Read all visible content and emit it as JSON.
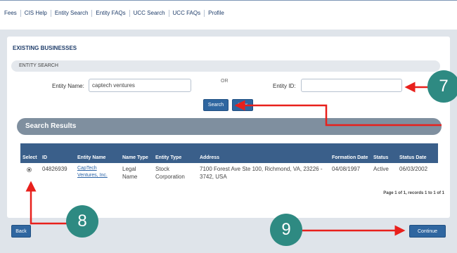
{
  "nav": {
    "links": [
      "Fees",
      "CIS Help",
      "Entity Search",
      "Entity FAQs",
      "UCC Search",
      "UCC FAQs",
      "Profile"
    ]
  },
  "page": {
    "title": "EXISTING BUSINESSES",
    "entity_search_label": "ENTITY SEARCH",
    "entity_name_label": "Entity Name:",
    "entity_name_value": "captech ventures",
    "or_label": "OR",
    "entity_id_label": "Entity ID:",
    "entity_id_value": "",
    "search_button": "Search",
    "clear_button": "Clear"
  },
  "results": {
    "header": "Search Results",
    "columns": [
      "Select",
      "ID",
      "Entity Name",
      "Name Type",
      "Entity Type",
      "Address",
      "Formation Date",
      "Status",
      "Status Date"
    ],
    "rows": [
      {
        "id": "04826939",
        "entity_name": "CapTech Ventures, Inc.",
        "name_type": "Legal Name",
        "entity_type": "Stock Corporation",
        "address": "7100 Forest Ave Ste 100, Richmond, VA, 23226 - 3742, USA",
        "formation_date": "04/08/1997",
        "status": "Active",
        "status_date": "06/03/2002"
      }
    ],
    "pager": "Page 1 of 1, records 1 to 1 of 1"
  },
  "buttons": {
    "back": "Back",
    "continue": "Continue"
  },
  "callouts": {
    "seven": "7",
    "eight": "8",
    "nine": "9"
  },
  "colors": {
    "accent_blue": "#2f66a0",
    "table_header": "#3a5f8a",
    "callout_teal": "#2e8a82",
    "arrow_red": "#e8201c"
  }
}
